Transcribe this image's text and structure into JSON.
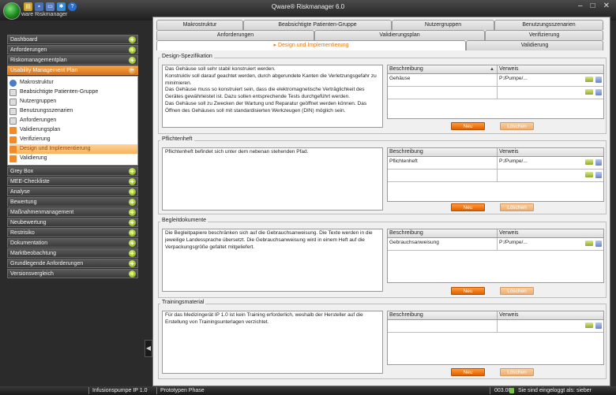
{
  "window": {
    "title": "Qware® Riskmanager  6.0",
    "app_sub": "ware Riskmanager",
    "controls": [
      "–",
      "□",
      "✕"
    ]
  },
  "sidebar": {
    "items_top": [
      "Dashboard",
      "Anforderungen",
      "Riskomanagementplan"
    ],
    "active": "Usability Management Plan",
    "sub_items": [
      {
        "label": "Makrostruktur",
        "icon": "eye-icon"
      },
      {
        "label": "Beabsichtigte Patienten-Gruppe",
        "icon": "document-icon"
      },
      {
        "label": "Nutzergruppen",
        "icon": "document-icon"
      },
      {
        "label": "Benutzungsszenarien",
        "icon": "document-icon"
      },
      {
        "label": "Anforderungen",
        "icon": "document-icon"
      },
      {
        "label": "Validierungsplan",
        "icon": "orange-document-icon"
      },
      {
        "label": "Verifizierung",
        "icon": "orange-document-icon"
      },
      {
        "label": "Design und Implementierung",
        "icon": "orange-document-icon",
        "selected": true
      },
      {
        "label": "Validierung",
        "icon": "orange-document-icon"
      }
    ],
    "items_bottom": [
      "Grey Box",
      "MEE-Checkliste",
      "Analyse",
      "Bewertung",
      "Maßnahmenmanagement",
      "Neubewertung",
      "Restrisiko",
      "Dokumentation",
      "Marktbeobachtung",
      "Grundlegende Anforderungen",
      "Versionsvergleich"
    ]
  },
  "tabs": {
    "row1": [
      "Makrostruktur",
      "Beabsichtigte Patienten-Gruppe",
      "Nutzergruppen",
      "Benutzungsszenarien"
    ],
    "row2": [
      "Anforderungen",
      "Validierungsplan",
      "Verifizierung"
    ],
    "row3_selected": "Design und Implementierung",
    "row3_other": "Validierung"
  },
  "table_headers": {
    "beschreibung": "Beschreibung",
    "verweis": "Verweis"
  },
  "buttons": {
    "new": "Neu",
    "delete": "Löschen"
  },
  "sections": [
    {
      "title": "Design-Spezifikation",
      "text": "Das Gehäuse soll sehr stabil konstruiert werden.\nKonstruktiv soll darauf geachtet werden, durch abgerundete Kanten die Verletzungsgefahr zu minimieren.\nDas Gehäuse muss so konstruiert sein, dass die elektromagnetische Verträglichkeit des Gerätes gewährleistet ist. Dazu sollen entsprechende Tests durchgeführt werden.\nDas Gehäuse soll zu Zwecken der Wartung und Reparatur geöffnet werden können. Das Öffnen des Gehäuses soll mit standardisierten Werkzeugen (DIN) möglich sein.",
      "rows": [
        {
          "beschreibung": "Gehäuse",
          "verweis": "P:/Pumpe/..."
        },
        {
          "beschreibung": "",
          "verweis": ""
        }
      ]
    },
    {
      "title": "Pflichtenheft",
      "text": "Pflichtenheft befindet sich unter dem nebenan stehenden Pfad.",
      "rows": [
        {
          "beschreibung": "Pflichtenheft",
          "verweis": "P:/Pumpe/..."
        },
        {
          "beschreibung": "",
          "verweis": ""
        }
      ]
    },
    {
      "title": "Begleitdokumente",
      "text": "Die Begleitpapiere beschränken sich auf die Gebrauchsanweisung. Die Texte werden in die jeweilige Landessprache übersetzt. Die Gebrauchsanweisung wird in einem Heft auf die Verpackungsgröße gefaltet mitgeliefert.",
      "rows": [
        {
          "beschreibung": "Gebrauchsanweisung",
          "verweis": "P:/Pumpe/..."
        }
      ]
    },
    {
      "title": "Trainingsmaterial",
      "text": "Für das Medizingerät IP 1.0 ist kein Training erforderlich, weshalb der Hersteller auf die Erstellung von Trainingsunterlagen verzichtet.",
      "rows": [
        {
          "beschreibung": "",
          "verweis": ""
        }
      ]
    }
  ],
  "status": {
    "project": "Infusionspumpe IP 1.0",
    "phase": "Prototypen Phase",
    "code": "003.00",
    "user": "Sie sind eingeloggt als: sieber"
  }
}
